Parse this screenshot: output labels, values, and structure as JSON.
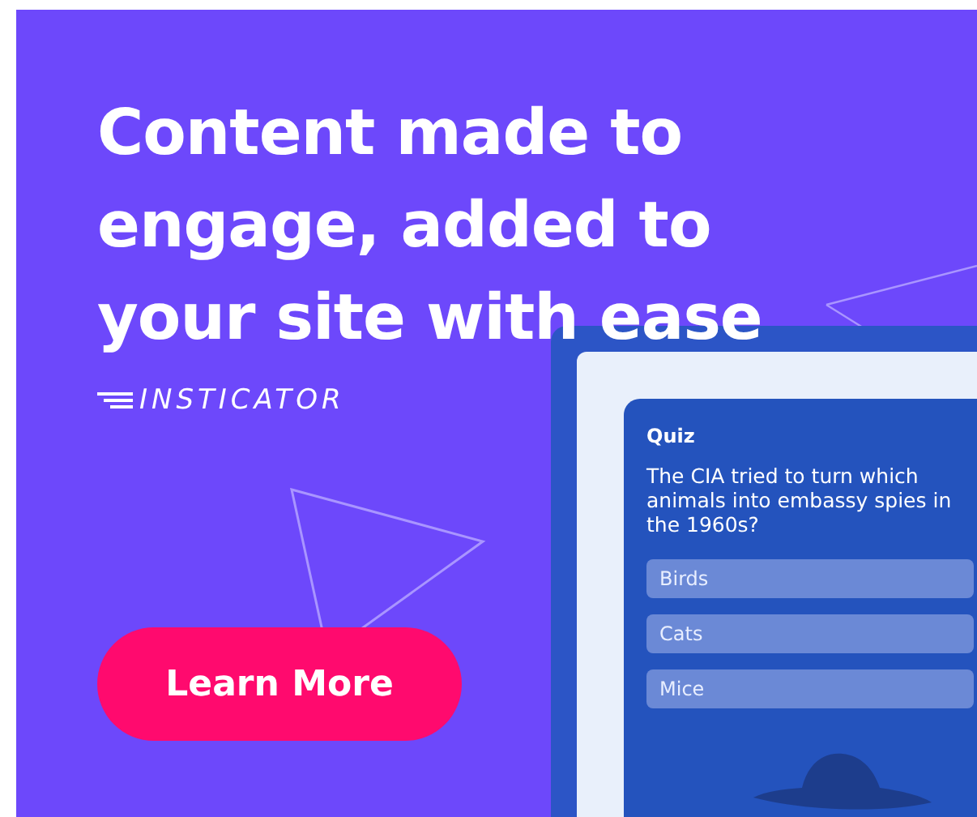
{
  "headline": "Content made to engage, added to your site with ease",
  "brand": "INSTICATOR",
  "cta": "Learn More",
  "quiz": {
    "title": "Quiz",
    "question": "The CIA tried to turn which animals into embassy spies in the 1960s?",
    "options": [
      "Birds",
      "Cats",
      "Mice"
    ]
  }
}
